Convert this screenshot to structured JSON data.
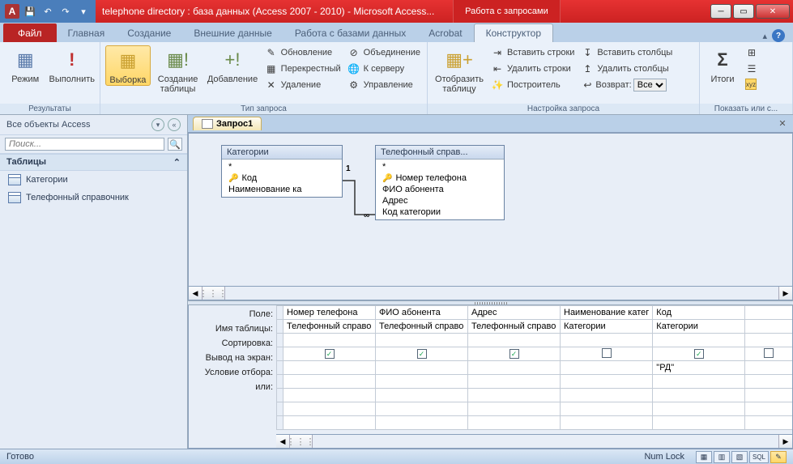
{
  "titlebar": {
    "app_letter": "A",
    "title": "telephone directory : база данных (Access 2007 - 2010)  -  Microsoft Access...",
    "context_title": "Работа с запросами"
  },
  "tabs": {
    "file": "Файл",
    "home": "Главная",
    "create": "Создание",
    "external": "Внешние данные",
    "dbtools": "Работа с базами данных",
    "acrobat": "Acrobat",
    "designer": "Конструктор"
  },
  "ribbon": {
    "results": {
      "view": "Режим",
      "run": "Выполнить",
      "label": "Результаты"
    },
    "qtype": {
      "select": "Выборка",
      "maketable": "Создание таблицы",
      "append": "Добавление",
      "update": "Обновление",
      "crosstab": "Перекрестный",
      "delete": "Удаление",
      "union": "Объединение",
      "passthrough": "К серверу",
      "datadef": "Управление",
      "label": "Тип запроса"
    },
    "setup": {
      "showtable": "Отобразить таблицу",
      "insrows": "Вставить строки",
      "delrows": "Удалить строки",
      "builder": "Построитель",
      "inscols": "Вставить столбцы",
      "delcols": "Удалить столбцы",
      "return": "Возврат:",
      "return_value": "Все",
      "label": "Настройка запроса"
    },
    "showhide": {
      "totals": "Итоги",
      "label": "Показать или с..."
    }
  },
  "nav": {
    "header": "Все объекты Access",
    "search_placeholder": "Поиск...",
    "group_tables": "Таблицы",
    "items": [
      "Категории",
      "Телефонный справочник"
    ]
  },
  "doc": {
    "tab": "Запрос1"
  },
  "designer_tables": {
    "t1": {
      "title": "Категории",
      "star": "*",
      "fields": [
        "Код",
        "Наименование ка"
      ]
    },
    "t2": {
      "title": "Телефонный справ...",
      "star": "*",
      "fields": [
        "Номер телефона",
        "ФИО абонента",
        "Адрес",
        "Код категории"
      ]
    },
    "rel_one": "1",
    "rel_many": "∞"
  },
  "grid": {
    "labels": {
      "field": "Поле:",
      "table": "Имя таблицы:",
      "sort": "Сортировка:",
      "show": "Вывод на экран:",
      "criteria": "Условие отбора:",
      "or": "или:"
    },
    "cols": [
      {
        "field": "Номер телефона",
        "table": "Телефонный справо",
        "show": true,
        "criteria": ""
      },
      {
        "field": "ФИО абонента",
        "table": "Телефонный справо",
        "show": true,
        "criteria": ""
      },
      {
        "field": "Адрес",
        "table": "Телефонный справо",
        "show": true,
        "criteria": ""
      },
      {
        "field": "Наименование катег",
        "table": "Категории",
        "show": false,
        "criteria": ""
      },
      {
        "field": "Код",
        "table": "Категории",
        "show": true,
        "criteria": "\"РД\""
      }
    ]
  },
  "status": {
    "ready": "Готово",
    "numlock": "Num Lock",
    "sql": "SQL"
  }
}
